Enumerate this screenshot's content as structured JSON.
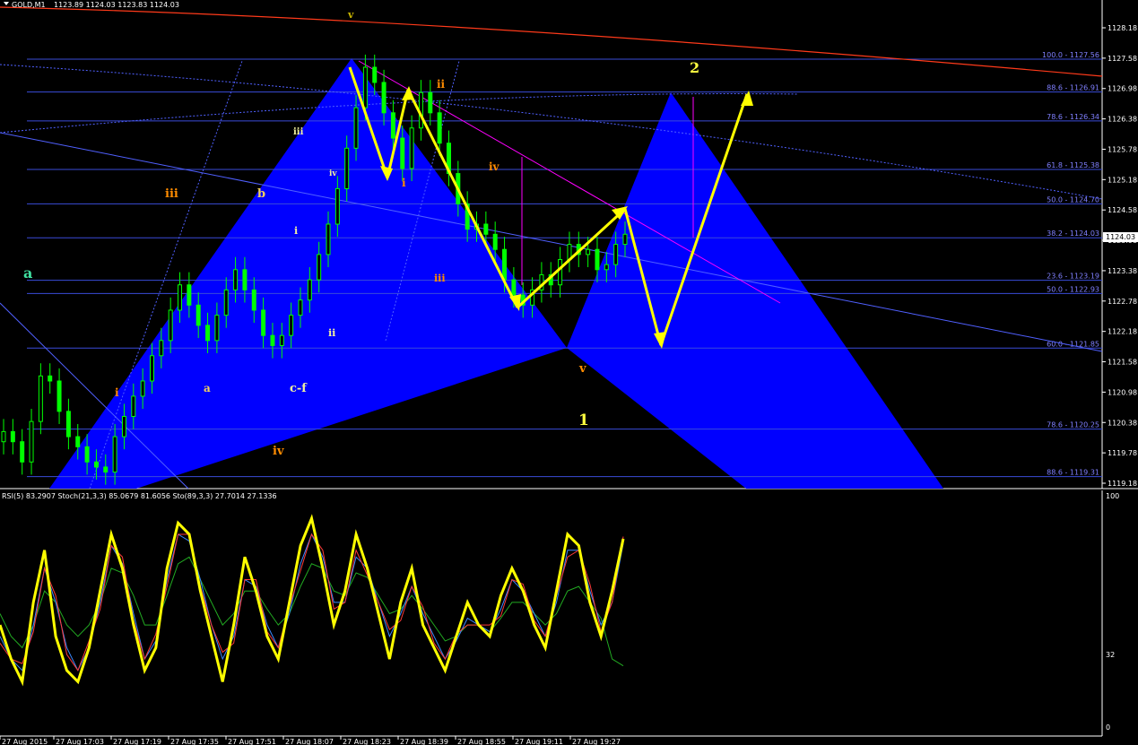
{
  "header": {
    "symbol": "GOLD,M1",
    "ohlc": "1123.89 1124.03 1123.83 1124.03"
  },
  "indicator_header": {
    "text": "RSI(5) 83.2907   Stoch(21,3,3) 85.0679 81.6056   Sto(89,3,3) 27.7014 27.1336"
  },
  "colors": {
    "background": "#000000",
    "harmonic_fill": "#0000ff",
    "trend_arrows": "#ffff00",
    "fib_lines": "#3a4bd8",
    "magenta_line": "#ff00ff",
    "red_curve": "#ff3a1a",
    "candles": "#00ff00",
    "rsi": "#ffff00",
    "stoch_main": "#ff3a3a",
    "stoch_signal": "#3a8aff",
    "sto_slow": "#22aa22"
  },
  "price_axis": {
    "ticks": [
      "1128.18",
      "1127.58",
      "1126.98",
      "1126.38",
      "1125.78",
      "1125.18",
      "1124.58",
      "1123.98",
      "1123.38",
      "1122.78",
      "1122.18",
      "1121.58",
      "1120.98",
      "1120.38",
      "1119.78",
      "1119.18"
    ],
    "current": "1124.03"
  },
  "fib_levels": [
    {
      "label": "100.0 - 1127.56",
      "price": 1127.56
    },
    {
      "label": "88.6 - 1126.91",
      "price": 1126.91
    },
    {
      "label": "78.6 - 1126.34",
      "price": 1126.34
    },
    {
      "label": "61.8 - 1125.38",
      "price": 1125.38
    },
    {
      "label": "50.0 - 1124.70",
      "price": 1124.7
    },
    {
      "label": "38.2 - 1124.03",
      "price": 1124.03
    },
    {
      "label": "23.6 - 1123.19",
      "price": 1123.19
    },
    {
      "label": "50.0 - 1122.93",
      "price": 1122.93
    },
    {
      "label": "60.0 - 1121.85",
      "price": 1121.85
    },
    {
      "label": "78.6 - 1120.25",
      "price": 1120.25
    },
    {
      "label": "88.6 - 1119.31",
      "price": 1119.31
    }
  ],
  "time_axis": [
    "27 Aug 2015",
    "27 Aug 17:03",
    "27 Aug 17:19",
    "27 Aug 17:35",
    "27 Aug 17:51",
    "27 Aug 18:07",
    "27 Aug 18:23",
    "27 Aug 18:39",
    "27 Aug 18:55",
    "27 Aug 19:11",
    "27 Aug 19:27"
  ],
  "indicator_axis": [
    "100",
    "32",
    "0"
  ],
  "wave_labels": [
    {
      "text": "v",
      "color": "#c8b400"
    },
    {
      "text": "ii",
      "color": "#ff8c00"
    },
    {
      "text": "iii",
      "color": "#f0f0a0"
    },
    {
      "text": "iv",
      "color": "#f0f0a0"
    },
    {
      "text": "i",
      "color": "#ff8c00"
    },
    {
      "text": "iv",
      "color": "#ff8c00"
    },
    {
      "text": "iii",
      "color": "#ff8c00"
    },
    {
      "text": "b",
      "color": "#f0d060"
    },
    {
      "text": "i",
      "color": "#f0f0a0"
    },
    {
      "text": "ii",
      "color": "#f0f0a0"
    },
    {
      "text": "a",
      "color": "#f0d060"
    },
    {
      "text": "c-f",
      "color": "#f0f0a0"
    },
    {
      "text": "iii",
      "color": "#ff8c00"
    },
    {
      "text": "a",
      "color": "#40e0a0"
    },
    {
      "text": "i",
      "color": "#ff8c00"
    },
    {
      "text": "iv",
      "color": "#ff8c00"
    },
    {
      "text": "iii",
      "color": "#ff8c00"
    },
    {
      "text": "v",
      "color": "#ff8c00"
    },
    {
      "text": "1",
      "color": "#ffff40"
    },
    {
      "text": "2",
      "color": "#ffff40"
    }
  ],
  "chart_data": [
    {
      "type": "candlestick",
      "title": "GOLD,M1",
      "xlabel": "",
      "ylabel": "",
      "ylim": [
        1119.18,
        1128.5
      ],
      "series": [
        {
          "name": "close",
          "values": [
            1120.2,
            1120.0,
            1119.6,
            1120.4,
            1121.3,
            1121.2,
            1120.6,
            1120.1,
            1119.9,
            1119.6,
            1119.5,
            1119.4,
            1120.1,
            1120.5,
            1120.9,
            1121.2,
            1121.7,
            1122.0,
            1122.6,
            1123.1,
            1122.7,
            1122.3,
            1122.0,
            1122.5,
            1123.0,
            1123.4,
            1123.0,
            1122.6,
            1122.1,
            1121.9,
            1122.1,
            1122.5,
            1122.8,
            1123.2,
            1123.7,
            1124.3,
            1125.0,
            1125.8,
            1126.6,
            1127.4,
            1127.1,
            1126.5,
            1126.0,
            1125.4,
            1126.2,
            1126.9,
            1126.5,
            1125.9,
            1125.3,
            1124.7,
            1124.2,
            1124.3,
            1124.1,
            1123.8,
            1123.2,
            1122.9,
            1122.7,
            1123.0,
            1123.3,
            1123.1,
            1123.6,
            1123.9,
            1123.7,
            1123.8,
            1123.4,
            1123.5,
            1123.9,
            1124.1
          ]
        }
      ]
    },
    {
      "type": "line",
      "title": "RSI(5) / Stoch(21,3,3) / Sto(89,3,3)",
      "ylim": [
        0,
        100
      ],
      "series": [
        {
          "name": "RSI(5)",
          "values": [
            45,
            30,
            20,
            55,
            78,
            40,
            25,
            20,
            35,
            60,
            85,
            70,
            45,
            25,
            35,
            70,
            90,
            85,
            60,
            40,
            20,
            45,
            75,
            60,
            40,
            30,
            55,
            80,
            92,
            70,
            45,
            60,
            85,
            70,
            50,
            30,
            55,
            70,
            45,
            35,
            25,
            40,
            55,
            45,
            40,
            58,
            70,
            60,
            45,
            35,
            60,
            85,
            80,
            55,
            40,
            60,
            83
          ]
        },
        {
          "name": "Stoch(21,3,3)",
          "values": [
            40,
            30,
            25,
            45,
            70,
            55,
            35,
            25,
            35,
            55,
            80,
            72,
            50,
            30,
            38,
            65,
            85,
            82,
            65,
            45,
            30,
            40,
            65,
            62,
            45,
            35,
            50,
            72,
            85,
            75,
            55,
            55,
            75,
            70,
            55,
            40,
            50,
            62,
            50,
            40,
            30,
            38,
            48,
            45,
            42,
            52,
            65,
            60,
            50,
            40,
            55,
            78,
            78,
            60,
            45,
            55,
            81
          ]
        },
        {
          "name": "Sto(89,3,3)",
          "values": [
            50,
            40,
            35,
            45,
            60,
            55,
            45,
            40,
            45,
            55,
            70,
            68,
            58,
            45,
            45,
            58,
            72,
            75,
            65,
            55,
            45,
            50,
            60,
            60,
            52,
            45,
            50,
            62,
            72,
            70,
            60,
            58,
            68,
            66,
            58,
            50,
            52,
            58,
            52,
            45,
            38,
            40,
            45,
            45,
            42,
            48,
            55,
            55,
            50,
            45,
            50,
            60,
            62,
            55,
            48,
            30,
            27
          ]
        }
      ]
    }
  ]
}
